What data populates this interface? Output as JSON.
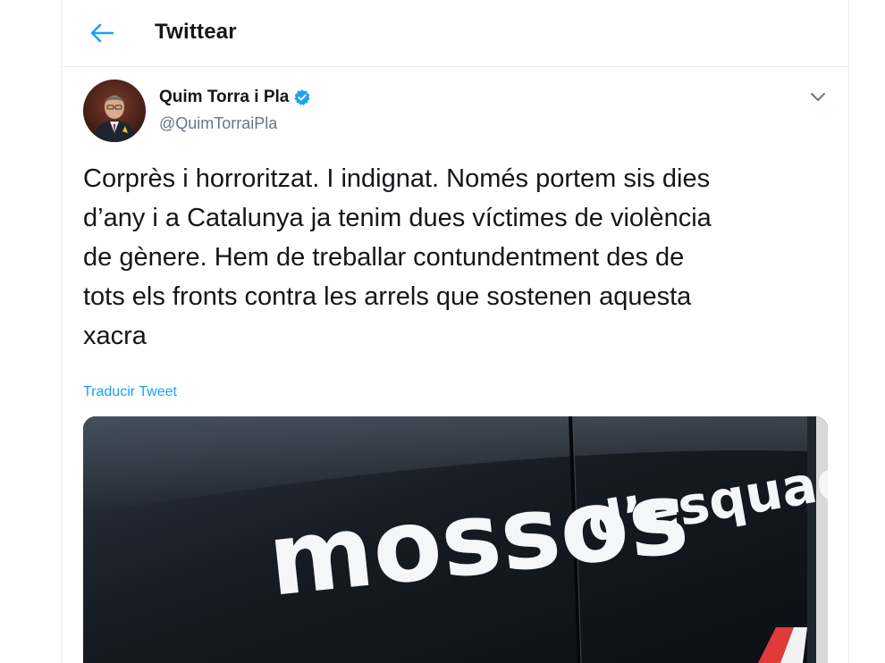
{
  "header": {
    "back_icon": "arrow-left-icon",
    "title": "Twittear"
  },
  "tweet": {
    "author_name": "Quim Torra i Pla",
    "verified_icon": "verified-badge-icon",
    "handle": "@QuimTorraiPla",
    "menu_icon": "chevron-down-icon",
    "text": "Corprès i horroritzat. I indignat. Només portem sis dies\nd’any i a Catalunya ja tenim dues víctimes de violència\nde gènere. Hem de treballar contundentment des de\ntots els fronts contra les arrels que sostenen aquesta\nxacra",
    "translate_label": "Traducir Tweet",
    "media": {
      "word1": "mossos",
      "word2": "d’esquadra"
    }
  },
  "colors": {
    "accent": "#1da1f2",
    "text": "#14171a",
    "secondary": "#657786",
    "border": "#e6ecf0"
  }
}
